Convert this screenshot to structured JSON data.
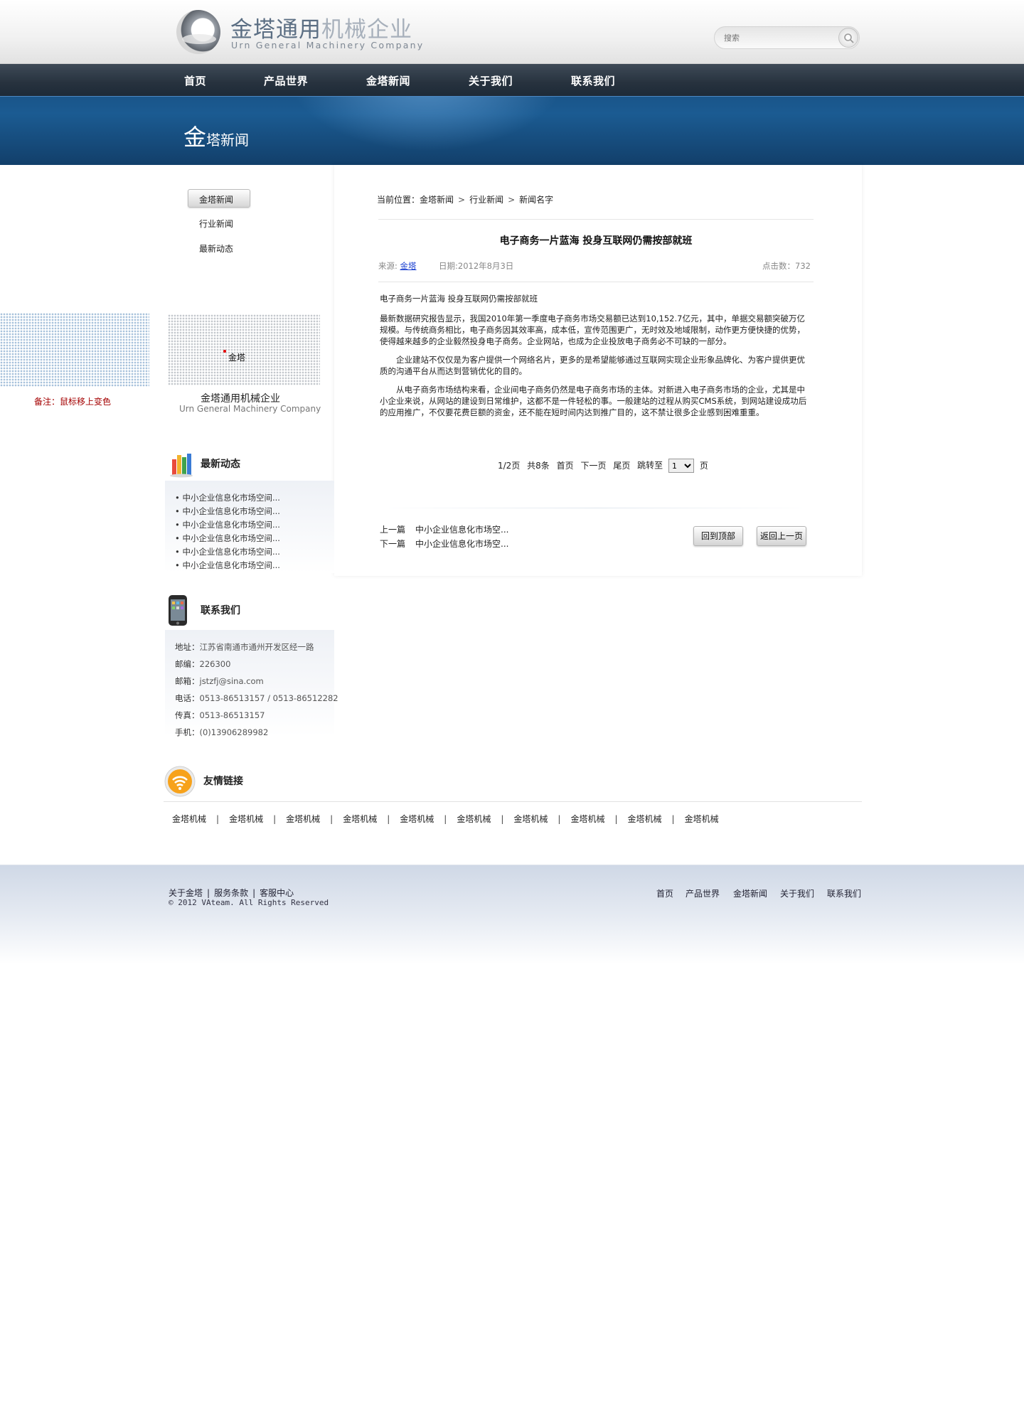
{
  "header": {
    "logo_cn_main": "金塔通用",
    "logo_cn_light": "机械企业",
    "logo_en": "Urn General Machinery Company",
    "search_placeholder": "搜索"
  },
  "nav": {
    "items": [
      "首页",
      "产品世界",
      "金塔新闻",
      "关于我们",
      "联系我们"
    ]
  },
  "banner": {
    "title_big": "金",
    "title_rest": "塔新闻"
  },
  "sidebar": {
    "nav_items": [
      "金塔新闻",
      "行业新闻",
      "最新动态"
    ],
    "map_label": "金塔",
    "company_cn": "金塔通用机械企业",
    "company_en": "Urn General Machinery Company",
    "note": "备注：鼠标移上变色",
    "latest": {
      "title": "最新动态",
      "items": [
        "中小企业信息化市场空间...",
        "中小企业信息化市场空间...",
        "中小企业信息化市场空间...",
        "中小企业信息化市场空间...",
        "中小企业信息化市场空间...",
        "中小企业信息化市场空间..."
      ]
    },
    "contact": {
      "title": "联系我们",
      "lines": [
        {
          "label": "地址：",
          "value": "江苏省南通市通州开发区经一路"
        },
        {
          "label": "邮编：",
          "value": "226300"
        },
        {
          "label": "邮箱：",
          "value": "jstzfj@sina.com"
        },
        {
          "label": "电话：",
          "value": "0513-86513157 / 0513-86512282"
        },
        {
          "label": "传真：",
          "value": "0513-86513157"
        },
        {
          "label": "手机：",
          "value": "(0)13906289982"
        }
      ]
    }
  },
  "breadcrumb": {
    "prefix": "当前位置：",
    "items": [
      "金塔新闻",
      "行业新闻",
      "新闻名字"
    ]
  },
  "article": {
    "title": "电子商务一片蓝海  投身互联网仍需按部就班",
    "source_label": "来源:",
    "source_link": "金塔",
    "date": "日期:2012年8月3日",
    "hits": "点击数：732",
    "paragraphs": [
      "电子商务一片蓝海  投身互联网仍需按部就班",
      "最新数据研究报告显示，我国2010年第一季度电子商务市场交易额已达到10,152.7亿元，其中，单据交易额突破万亿规模。与传统商务相比，电子商务因其效率高，成本低，宣传范围更广，无时效及地域限制，动作更方便快捷的优势，使得越来越多的企业毅然投身电子商务。企业网站，也成为企业投放电子商务必不可缺的一部分。",
      "　　企业建站不仅仅是为客户提供一个网络名片，更多的是希望能够通过互联网实现企业形象品牌化、为客户提供更优质的沟通平台从而达到营销优化的目的。",
      "　　从电子商务市场结构来看，企业间电子商务仍然是电子商务市场的主体。对新进入电子商务市场的企业，尤其是中小企业来说，从网站的建设到日常维护，这都不是一件轻松的事。一般建站的过程从购买CMS系统，到网站建设成功后的应用推广，不仅要花费巨额的资金，还不能在短时间内达到推广目的，这不禁让很多企业感到困难重重。"
    ]
  },
  "pager": {
    "info": "1/2页",
    "total": "共8条",
    "first": "首页",
    "next": "下一页",
    "last": "尾页",
    "jump": "跳转至",
    "current": "1",
    "unit": "页"
  },
  "prevnext": {
    "prev_label": "上一篇",
    "prev_title": "中小企业信息化市场空...",
    "next_label": "下一篇",
    "next_title": "中小企业信息化市场空..."
  },
  "buttons": {
    "top": "回到顶部",
    "back": "返回上一页"
  },
  "links": {
    "title": "友情链接",
    "items": [
      "金塔机械",
      "金塔机械",
      "金塔机械",
      "金塔机械",
      "金塔机械",
      "金塔机械",
      "金塔机械",
      "金塔机械",
      "金塔机械",
      "金塔机械"
    ]
  },
  "footer": {
    "left_links": [
      "关于金塔",
      "服务条款",
      "客服中心"
    ],
    "copyright": "© 2012 VAteam. All Rights Reserved",
    "nav": [
      "首页",
      "产品世界",
      "金塔新闻",
      "关于我们",
      "联系我们"
    ]
  }
}
